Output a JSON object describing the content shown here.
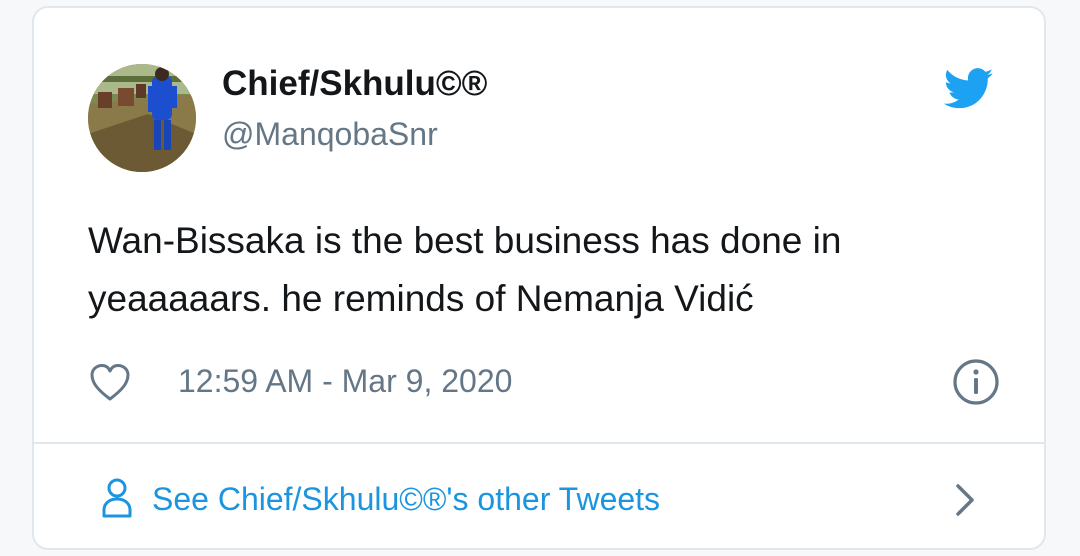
{
  "tweet": {
    "display_name": "Chief/Skhulu©®",
    "handle": "@ManqobaSnr",
    "text": "Wan-Bissaka is the best business has done in yeaaaaars. he reminds of Nemanja Vidić",
    "timestamp": "12:59 AM - Mar 9, 2020"
  },
  "footer": {
    "link_text": "See Chief/Skhulu©®'s other Tweets"
  },
  "icons": {
    "logo": "twitter-bird-icon",
    "like": "heart-icon",
    "info": "info-icon",
    "profile": "person-icon",
    "more": "chevron-right-icon"
  },
  "colors": {
    "brand": "#1da1f2",
    "link": "#1b95e0",
    "secondary_text": "#657786",
    "primary_text": "#14171a",
    "border": "#e1e8ed"
  }
}
